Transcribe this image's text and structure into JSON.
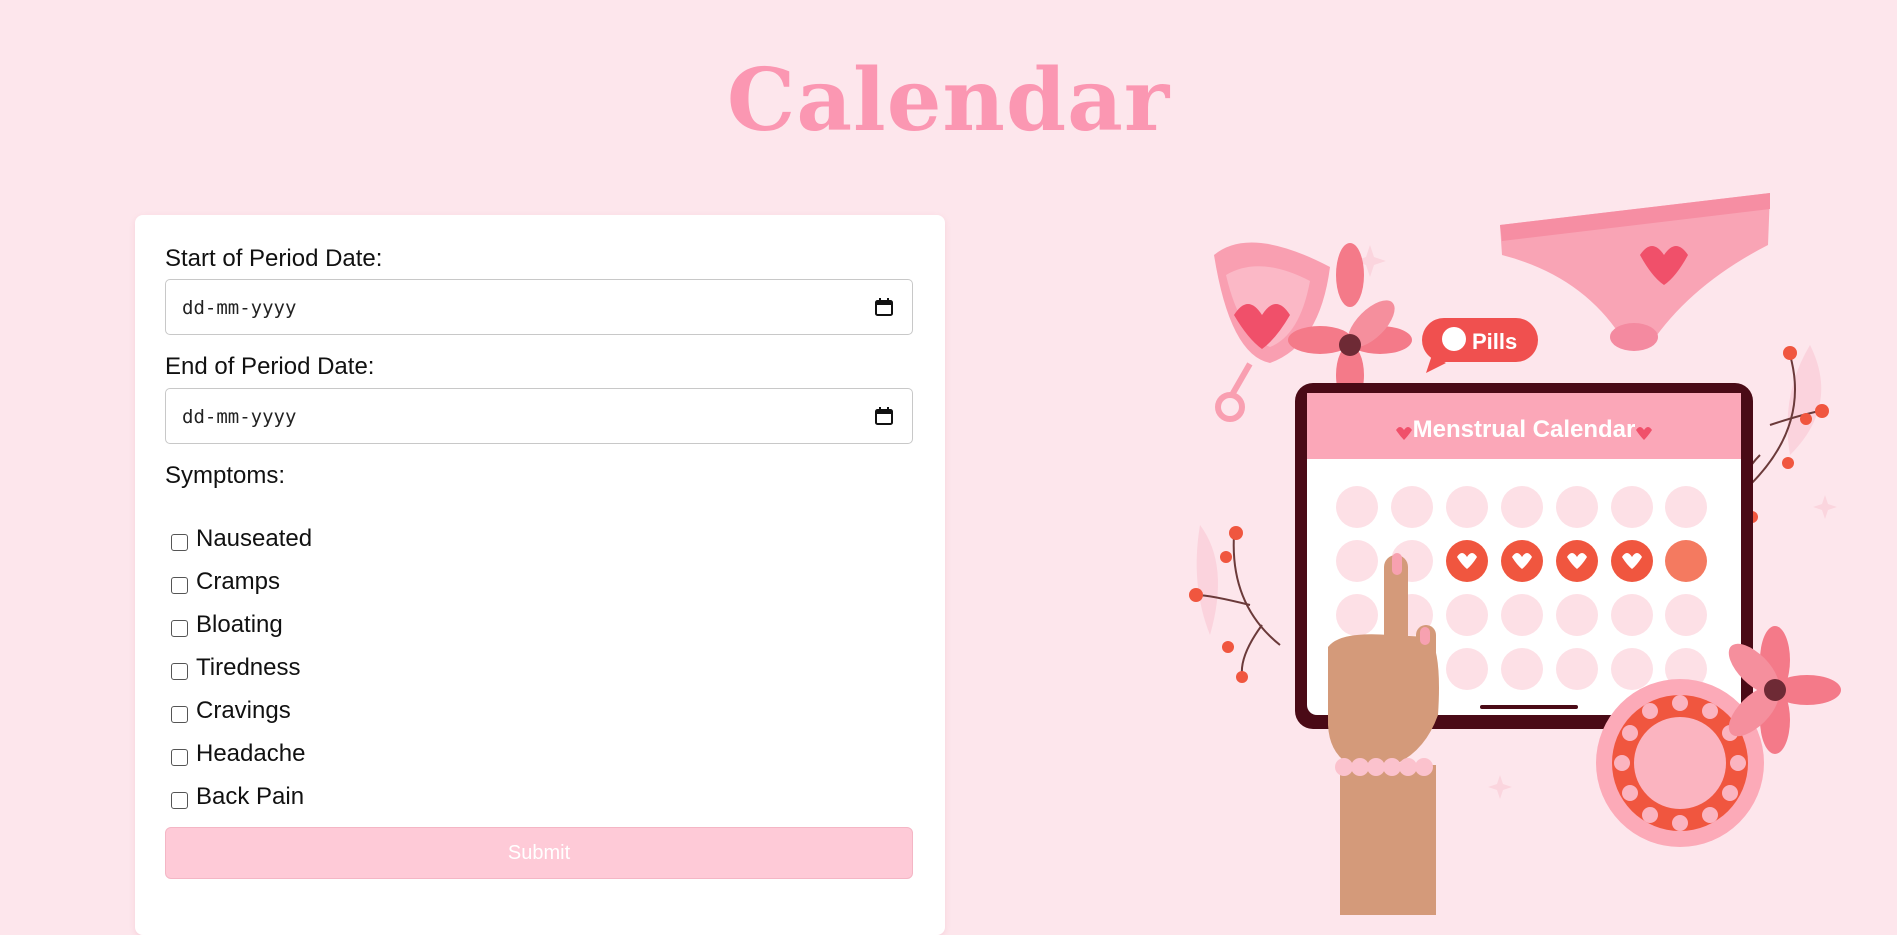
{
  "page": {
    "title": "Calendar"
  },
  "form": {
    "start_label": "Start of Period Date:",
    "start_placeholder": "dd-mm-yyyy",
    "end_label": "End of Period Date:",
    "end_placeholder": "dd-mm-yyyy",
    "symptoms_label": "Symptoms:",
    "symptoms": [
      "Nauseated",
      "Cramps",
      "Bloating",
      "Tiredness",
      "Cravings",
      "Headache",
      "Back Pain"
    ],
    "submit_label": "Submit"
  },
  "illustration": {
    "tablet_title": "Menstrual Calendar",
    "pills_label": "Pills",
    "highlighted_days": 5
  },
  "colors": {
    "background": "#fde6ec",
    "title": "#fb97b2",
    "submit": "#fecad7",
    "accent_red": "#f0563f",
    "tablet_frame": "#4a0a16"
  }
}
